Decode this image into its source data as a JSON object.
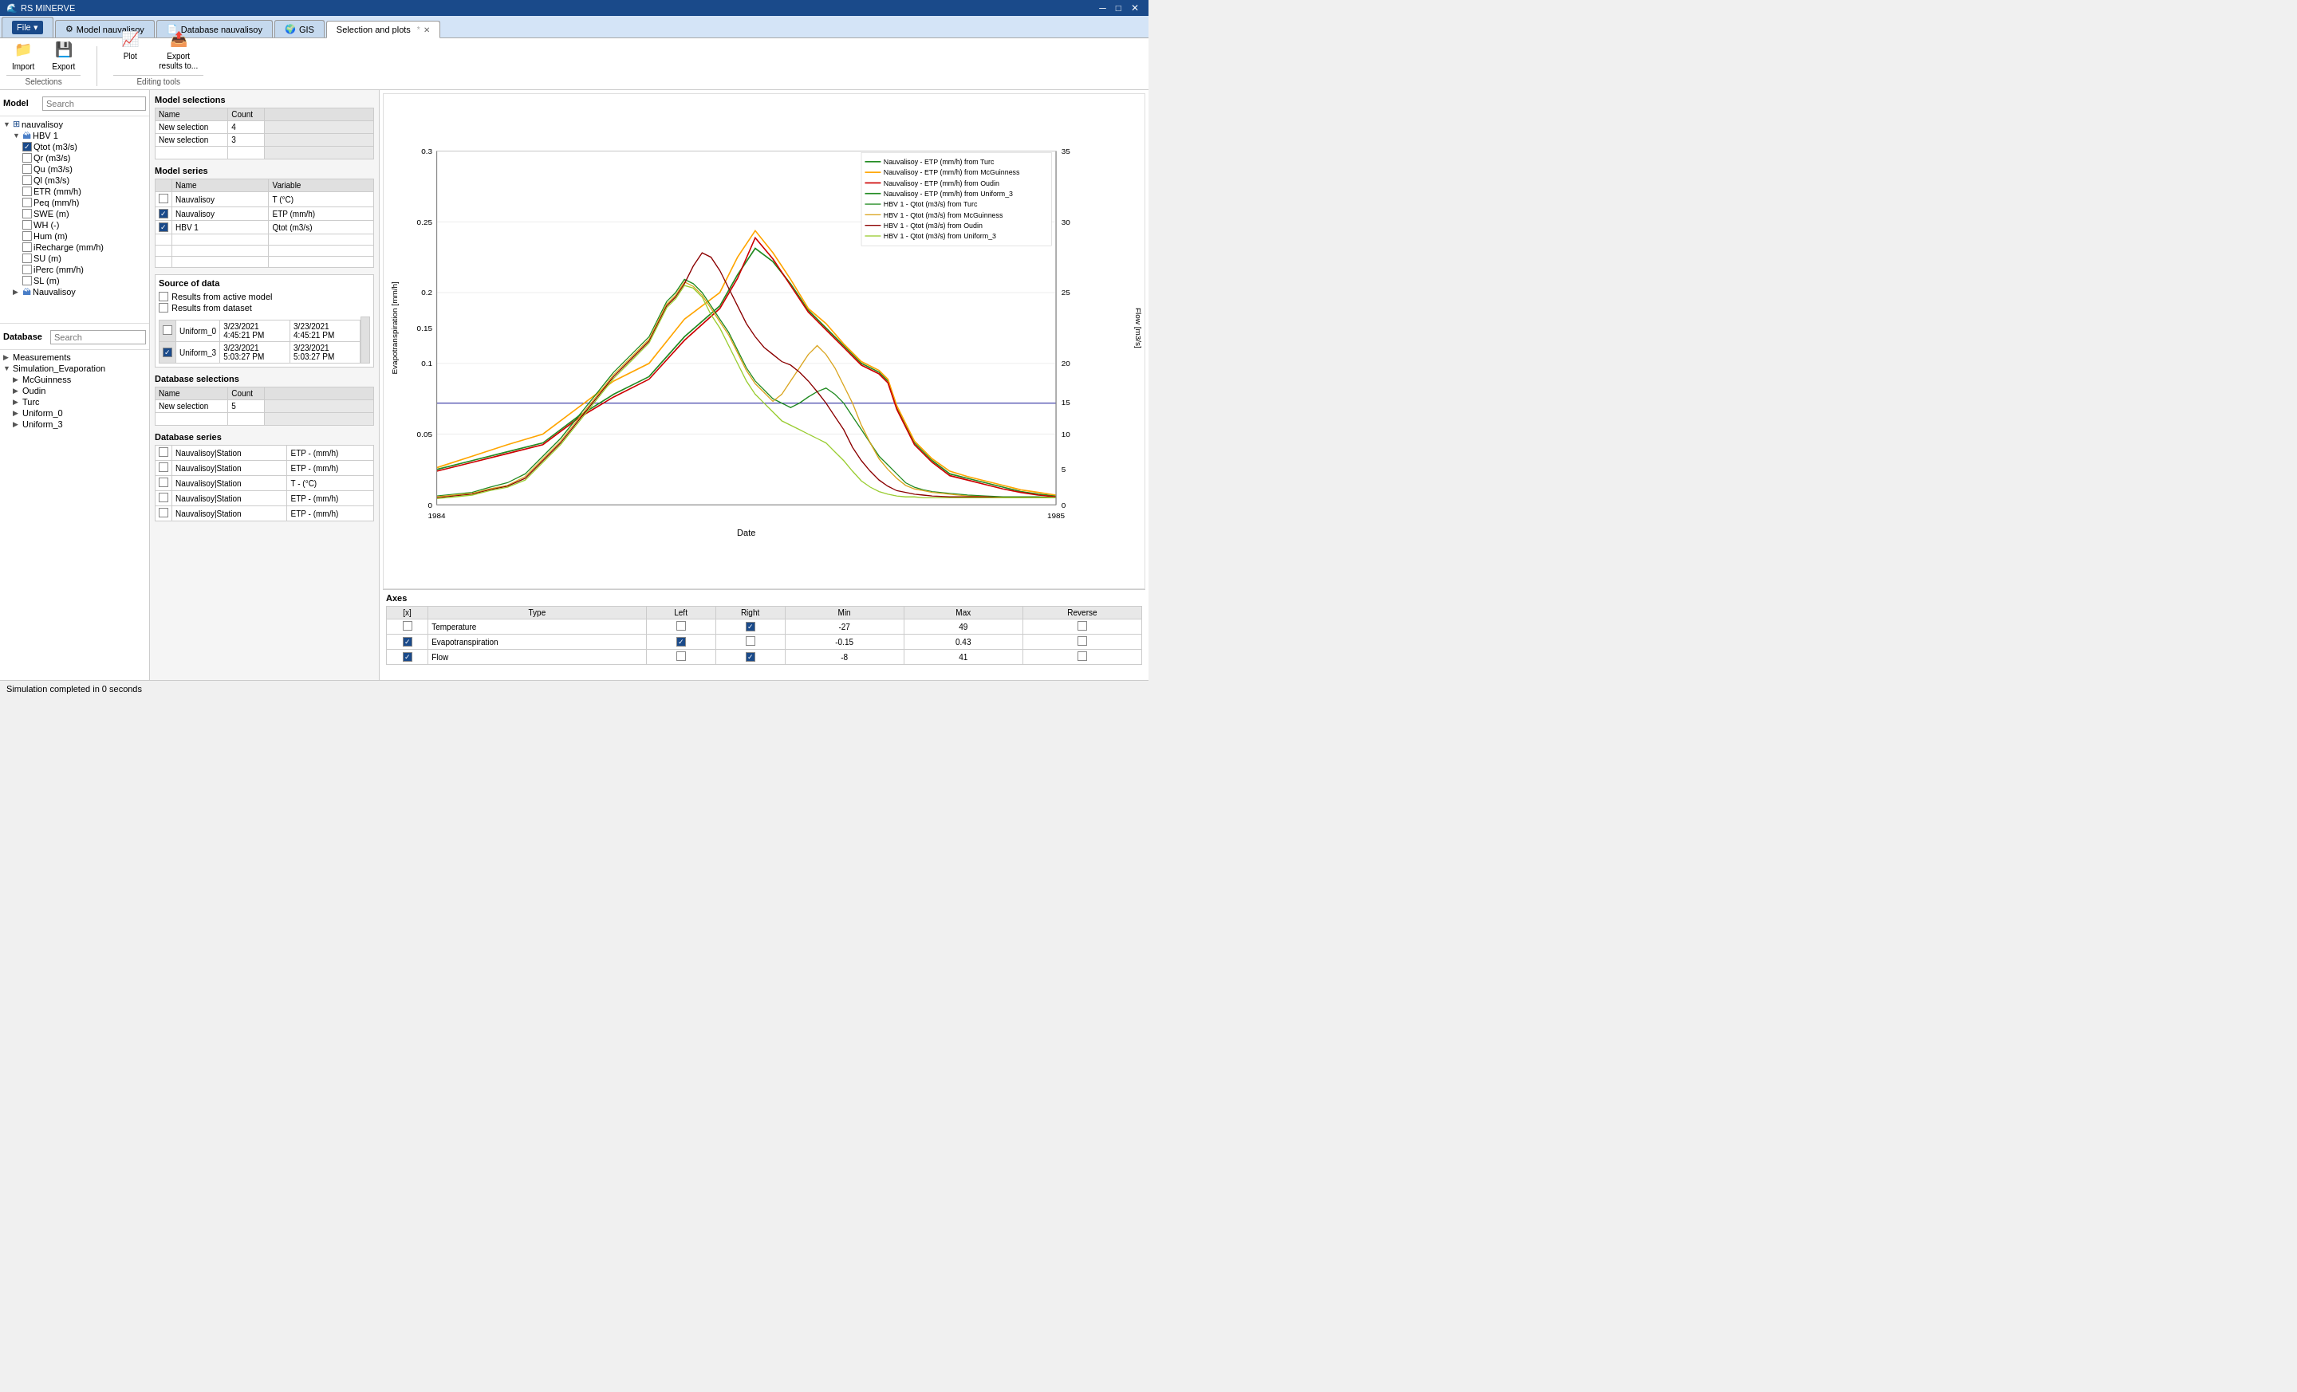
{
  "app": {
    "title": "RS MINERVE",
    "logo": "🌐"
  },
  "titlebar": {
    "controls": [
      "─",
      "□",
      "✕"
    ]
  },
  "tabs": [
    {
      "id": "file",
      "label": "File",
      "type": "menu",
      "active": false
    },
    {
      "id": "model",
      "label": "Model nauvalisoy",
      "icon": "⚙",
      "active": false
    },
    {
      "id": "database",
      "label": "Database nauvalisoy",
      "icon": "📄",
      "active": false
    },
    {
      "id": "gis",
      "label": "GIS",
      "icon": "🌍",
      "active": false
    },
    {
      "id": "selplots",
      "label": "Selection and plots",
      "icon": "",
      "active": true,
      "closeable": true
    }
  ],
  "toolbar": {
    "groups": [
      {
        "label": "Selections",
        "buttons": [
          {
            "id": "import",
            "label": "Import",
            "icon": "📁"
          },
          {
            "id": "export",
            "label": "Export",
            "icon": "💾"
          }
        ]
      },
      {
        "label": "Editing tools",
        "buttons": [
          {
            "id": "plot",
            "label": "Plot",
            "icon": "📈"
          },
          {
            "id": "export-results",
            "label": "Export\nresults to...",
            "icon": "📤"
          }
        ]
      }
    ]
  },
  "left": {
    "model_label": "Model",
    "model_search_placeholder": "Search",
    "model_tree": [
      {
        "id": "nauvalisoy",
        "label": "nauvalisoy",
        "level": 0,
        "type": "root",
        "expanded": true
      },
      {
        "id": "hbv1",
        "label": "HBV 1",
        "level": 1,
        "type": "node",
        "expanded": true
      },
      {
        "id": "qtot",
        "label": "Qtot (m3/s)",
        "level": 2,
        "type": "check",
        "checked": true
      },
      {
        "id": "qr",
        "label": "Qr (m3/s)",
        "level": 2,
        "type": "check",
        "checked": false
      },
      {
        "id": "qu",
        "label": "Qu (m3/s)",
        "level": 2,
        "type": "check",
        "checked": false
      },
      {
        "id": "ql",
        "label": "Ql (m3/s)",
        "level": 2,
        "type": "check",
        "checked": false
      },
      {
        "id": "etr",
        "label": "ETR (mm/h)",
        "level": 2,
        "type": "check",
        "checked": false
      },
      {
        "id": "peq",
        "label": "Peq (mm/h)",
        "level": 2,
        "type": "check",
        "checked": false
      },
      {
        "id": "swe",
        "label": "SWE (m)",
        "level": 2,
        "type": "check",
        "checked": false
      },
      {
        "id": "wh",
        "label": "WH (-)",
        "level": 2,
        "type": "check",
        "checked": false
      },
      {
        "id": "hum",
        "label": "Hum (m)",
        "level": 2,
        "type": "check",
        "checked": false
      },
      {
        "id": "irecharge",
        "label": "iRecharge (mm/h)",
        "level": 2,
        "type": "check",
        "checked": false
      },
      {
        "id": "su",
        "label": "SU (m)",
        "level": 2,
        "type": "check",
        "checked": false
      },
      {
        "id": "iperc",
        "label": "iPerc (mm/h)",
        "level": 2,
        "type": "check",
        "checked": false
      },
      {
        "id": "sl",
        "label": "SL (m)",
        "level": 2,
        "type": "check",
        "checked": false
      },
      {
        "id": "nauvalisoy2",
        "label": "Nauvalisoy",
        "level": 1,
        "type": "leaf"
      }
    ],
    "database_label": "Database",
    "database_search_placeholder": "Search",
    "database_tree": [
      {
        "id": "measurements",
        "label": "Measurements",
        "level": 0,
        "type": "leaf"
      },
      {
        "id": "simevap",
        "label": "Simulation_Evaporation",
        "level": 0,
        "type": "node",
        "expanded": true
      },
      {
        "id": "mcguinness",
        "label": "McGuinness",
        "level": 1,
        "type": "leaf"
      },
      {
        "id": "oudin",
        "label": "Oudin",
        "level": 1,
        "type": "leaf"
      },
      {
        "id": "turc",
        "label": "Turc",
        "level": 1,
        "type": "leaf"
      },
      {
        "id": "uniform0",
        "label": "Uniform_0",
        "level": 1,
        "type": "leaf"
      },
      {
        "id": "uniform3",
        "label": "Uniform_3",
        "level": 1,
        "type": "leaf"
      }
    ]
  },
  "middle": {
    "model_selections_title": "Model selections",
    "model_selections_cols": [
      "Name",
      "Count"
    ],
    "model_selections_rows": [
      {
        "name": "New selection",
        "count": "4"
      },
      {
        "name": "New selection",
        "count": "3"
      }
    ],
    "model_series_title": "Model series",
    "model_series_cols": [
      "",
      "Name",
      "Variable"
    ],
    "model_series_rows": [
      {
        "checked": false,
        "name": "Nauvalisoy",
        "variable": "T (°C)"
      },
      {
        "checked": true,
        "name": "Nauvalisoy",
        "variable": "ETP (mm/h)"
      },
      {
        "checked": true,
        "name": "HBV 1",
        "variable": "Qtot (m3/s)"
      }
    ],
    "source_title": "Source of data",
    "source_active_model": "Results from active model",
    "source_dataset": "Results from dataset",
    "source_dataset_rows": [
      {
        "checked": false,
        "name": "Uniform_0",
        "from": "3/23/2021 4:45:21 PM",
        "to": "3/23/2021 4:45:21 PM"
      },
      {
        "checked": true,
        "name": "Uniform_3",
        "from": "3/23/2021 5:03:27 PM",
        "to": "3/23/2021 5:03:27 PM"
      }
    ],
    "database_selections_title": "Database selections",
    "database_selections_cols": [
      "Name",
      "Count"
    ],
    "database_selections_rows": [
      {
        "name": "New selection",
        "count": "5"
      }
    ],
    "database_series_title": "Database series",
    "database_series_rows": [
      {
        "checked": false,
        "name": "Nauvalisoy|Station",
        "variable": "ETP - (mm/h)"
      },
      {
        "checked": false,
        "name": "Nauvalisoy|Station",
        "variable": "ETP - (mm/h)"
      },
      {
        "checked": false,
        "name": "Nauvalisoy|Station",
        "variable": "T - (°C)"
      },
      {
        "checked": false,
        "name": "Nauvalisoy|Station",
        "variable": "ETP - (mm/h)"
      },
      {
        "checked": false,
        "name": "Nauvalisoy|Station",
        "variable": "ETP - (mm/h)"
      }
    ]
  },
  "chart": {
    "x_label": "Date",
    "y_left_label": "Evapotranspiration [mm/h]",
    "y_right_label": "Flow [m3/s]",
    "x_min": "1984",
    "x_max": "1985",
    "y_left_min": "0",
    "y_left_max": "0.3",
    "y_right_min": "0",
    "y_right_max": "35",
    "legend": [
      {
        "label": "Nauvalisoy - ETP (mm/h) from Turc",
        "color": "#228B22"
      },
      {
        "label": "Nauvalisoy - ETP (mm/h) from McGuinness",
        "color": "#FFA500"
      },
      {
        "label": "Nauvalisoy - ETP (mm/h) from Oudin",
        "color": "#CC0000"
      },
      {
        "label": "Nauvalisoy - ETP (mm/h) from Uniform_3",
        "color": "#228B22"
      },
      {
        "label": "HBV 1 - Qtot (m3/s) from Turc",
        "color": "#228B22"
      },
      {
        "label": "HBV 1 - Qtot (m3/s) from McGuinness",
        "color": "#FFA500"
      },
      {
        "label": "HBV 1 - Qtot (m3/s) from Oudin",
        "color": "#CC0000"
      },
      {
        "label": "HBV 1 - Qtot (m3/s) from Uniform_3",
        "color": "#228B22"
      }
    ]
  },
  "axes": {
    "title": "Axes",
    "cols": [
      "[x]",
      "Type",
      "Left",
      "Right",
      "Min",
      "Max",
      "Reverse"
    ],
    "rows": [
      {
        "x_checked": false,
        "type": "Temperature",
        "left": false,
        "right": true,
        "min": "-27",
        "max": "49",
        "reverse": false
      },
      {
        "x_checked": true,
        "type": "Evapotranspiration",
        "left": true,
        "right": false,
        "min": "-0.15",
        "max": "0.43",
        "reverse": false
      },
      {
        "x_checked": true,
        "type": "Flow",
        "left": false,
        "right": true,
        "min": "-8",
        "max": "41",
        "reverse": false
      }
    ]
  },
  "status_bar": {
    "text": "Simulation completed in 0 seconds"
  }
}
